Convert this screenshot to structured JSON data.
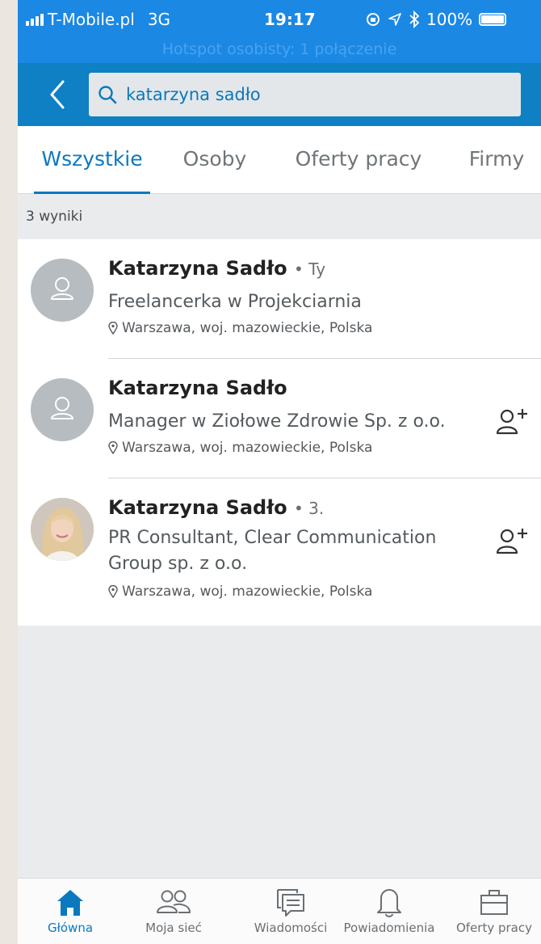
{
  "status_bar": {
    "carrier": "T-Mobile.pl",
    "network": "3G",
    "time": "19:17",
    "battery": "100%"
  },
  "hotspot_text": "Hotspot osobisty: 1 połączenie",
  "search": {
    "query": "katarzyna sadło"
  },
  "tabs": [
    {
      "label": "Wszystkie",
      "active": true
    },
    {
      "label": "Osoby",
      "active": false
    },
    {
      "label": "Oferty pracy",
      "active": false
    },
    {
      "label": "Firmy",
      "active": false
    }
  ],
  "results_count": "3 wyniki",
  "results": [
    {
      "name": "Katarzyna Sadło",
      "degree": "• Ty",
      "headline": "Freelancerka w Projekciarnia",
      "location": "Warszawa, woj. mazowieckie, Polska",
      "avatar": "placeholder-person-icon",
      "connect_button": false
    },
    {
      "name": "Katarzyna Sadło",
      "degree": "",
      "headline": "Manager w Ziołowe Zdrowie Sp. z o.o.",
      "location": "Warszawa, woj. mazowieckie, Polska",
      "avatar": "placeholder-person-icon",
      "connect_button": true
    },
    {
      "name": "Katarzyna Sadło",
      "degree": "• 3.",
      "headline": "PR Consultant, Clear Communication Group sp. z o.o.",
      "location": "Warszawa, woj. mazowieckie, Polska",
      "avatar": "profile-photo",
      "connect_button": true
    }
  ],
  "bottom_nav": [
    {
      "label": "Główna",
      "icon": "home-icon",
      "active": true
    },
    {
      "label": "Moja sieć",
      "icon": "network-icon",
      "active": false
    },
    {
      "label": "Wiadomości",
      "icon": "messages-icon",
      "active": false
    },
    {
      "label": "Powiadomienia",
      "icon": "bell-icon",
      "active": false
    },
    {
      "label": "Oferty pracy",
      "icon": "briefcase-icon",
      "active": false
    }
  ],
  "colors": {
    "accent": "#0b79be",
    "header": "#0f80c3",
    "status_bar": "#1b88e4"
  }
}
